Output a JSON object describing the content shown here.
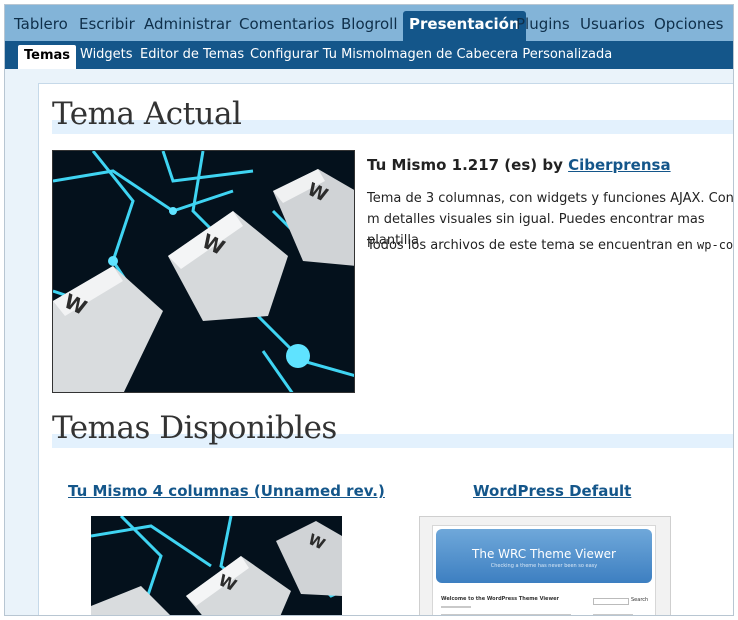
{
  "nav": {
    "items": [
      {
        "label": "Tablero"
      },
      {
        "label": "Escribir"
      },
      {
        "label": "Administrar"
      },
      {
        "label": "Comentarios"
      },
      {
        "label": "Blogroll"
      },
      {
        "label": "Presentación",
        "active": true
      },
      {
        "label": "Plugins"
      },
      {
        "label": "Usuarios"
      },
      {
        "label": "Opciones"
      }
    ]
  },
  "subnav": {
    "items": [
      {
        "label": "Temas",
        "active": true
      },
      {
        "label": "Widgets"
      },
      {
        "label": "Editor de Temas"
      },
      {
        "label": "Configurar Tu Mismo"
      },
      {
        "label": "Imagen de Cabecera Personalizada"
      }
    ]
  },
  "current": {
    "heading": "Tema Actual",
    "title": "Tu Mismo 1.217 (es) by",
    "author": "Ciberprensa",
    "description": "Tema de 3 columnas, con widgets y funciones AJAX. Con m detalles visuales sin igual. Puedes encontrar mas plantilla",
    "files_prefix": "Todos los archivos de este tema se encuentran en",
    "files_path": "wp-con"
  },
  "available": {
    "heading": "Temas Disponibles",
    "themes": [
      {
        "name": "Tu Mismo 4 columnas (Unnamed rev.)"
      },
      {
        "name": "WordPress Default"
      }
    ],
    "preview": {
      "banner_title": "The WRC Theme Viewer",
      "banner_subtitle": "Checking a theme has never been so easy",
      "post_title": "Welcome to the WordPress Theme Viewer",
      "search_label": "Search"
    }
  },
  "keyboard_image": {
    "key_letter": "W"
  },
  "colors": {
    "nav_bg": "#83b4d8",
    "subnav_bg": "#14568a",
    "link": "#14568a",
    "heading_bar": "#e3f1fd"
  }
}
